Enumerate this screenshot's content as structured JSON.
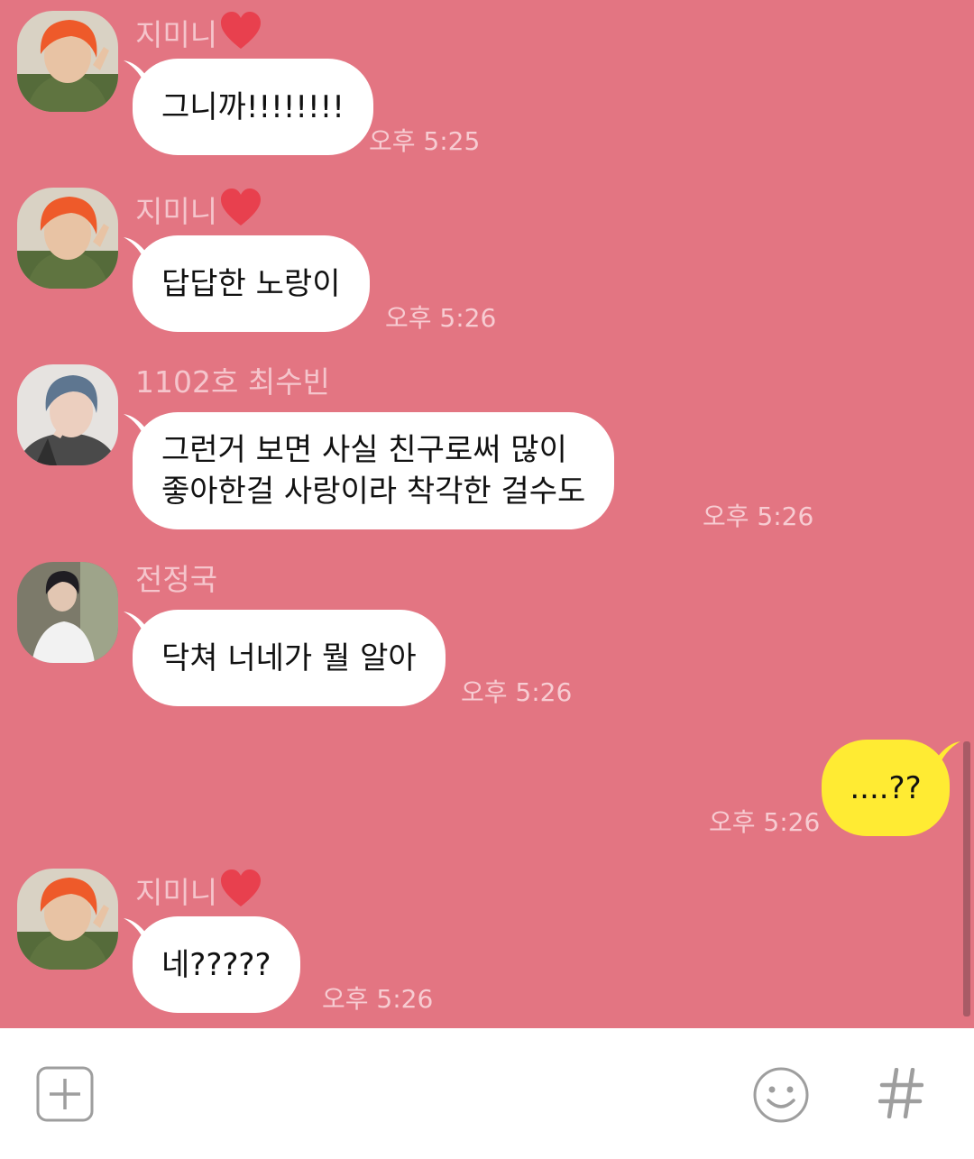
{
  "theme": {
    "background": "#E37582",
    "bubble_other": "#FFFFFF",
    "bubble_mine": "#FFEB33",
    "sender_color": "#F5C5CC",
    "time_color": "#F7CCD2",
    "heart_color": "#E8404E",
    "icon_gray": "#9E9E9E"
  },
  "messages": [
    {
      "sender": "지미니",
      "heart": true,
      "avatar": "orange-hair-avatar",
      "text": "그니까!!!!!!!!",
      "time": "오후 5:25"
    },
    {
      "sender": "지미니",
      "heart": true,
      "avatar": "orange-hair-avatar",
      "text": "답답한 노랑이",
      "time": "오후 5:26"
    },
    {
      "sender": "1102호 최수빈",
      "heart": false,
      "avatar": "blue-hair-avatar",
      "text": "그런거 보면 사실 친구로써 많이\n좋아한걸 사랑이라 착각한 걸수도",
      "time": "오후 5:26"
    },
    {
      "sender": "전정국",
      "heart": false,
      "avatar": "dark-hair-avatar",
      "text": "닥쳐 너네가 뭘 알아",
      "time": "오후 5:26"
    },
    {
      "mine": true,
      "text": "....??",
      "time": "오후 5:26"
    },
    {
      "sender": "지미니",
      "heart": true,
      "avatar": "orange-hair-avatar",
      "text": "네?????",
      "time": "오후 5:26"
    }
  ],
  "input_bar": {
    "icons": [
      "add-icon",
      "emoji-icon",
      "hashtag-icon"
    ]
  }
}
